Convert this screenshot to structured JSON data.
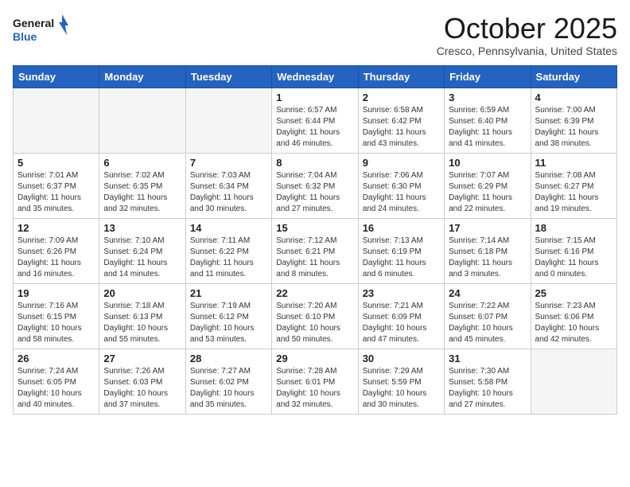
{
  "header": {
    "logo_line1": "General",
    "logo_line2": "Blue",
    "month": "October 2025",
    "location": "Cresco, Pennsylvania, United States"
  },
  "weekdays": [
    "Sunday",
    "Monday",
    "Tuesday",
    "Wednesday",
    "Thursday",
    "Friday",
    "Saturday"
  ],
  "weeks": [
    [
      {
        "day": "",
        "info": ""
      },
      {
        "day": "",
        "info": ""
      },
      {
        "day": "",
        "info": ""
      },
      {
        "day": "1",
        "info": "Sunrise: 6:57 AM\nSunset: 6:44 PM\nDaylight: 11 hours\nand 46 minutes."
      },
      {
        "day": "2",
        "info": "Sunrise: 6:58 AM\nSunset: 6:42 PM\nDaylight: 11 hours\nand 43 minutes."
      },
      {
        "day": "3",
        "info": "Sunrise: 6:59 AM\nSunset: 6:40 PM\nDaylight: 11 hours\nand 41 minutes."
      },
      {
        "day": "4",
        "info": "Sunrise: 7:00 AM\nSunset: 6:39 PM\nDaylight: 11 hours\nand 38 minutes."
      }
    ],
    [
      {
        "day": "5",
        "info": "Sunrise: 7:01 AM\nSunset: 6:37 PM\nDaylight: 11 hours\nand 35 minutes."
      },
      {
        "day": "6",
        "info": "Sunrise: 7:02 AM\nSunset: 6:35 PM\nDaylight: 11 hours\nand 32 minutes."
      },
      {
        "day": "7",
        "info": "Sunrise: 7:03 AM\nSunset: 6:34 PM\nDaylight: 11 hours\nand 30 minutes."
      },
      {
        "day": "8",
        "info": "Sunrise: 7:04 AM\nSunset: 6:32 PM\nDaylight: 11 hours\nand 27 minutes."
      },
      {
        "day": "9",
        "info": "Sunrise: 7:06 AM\nSunset: 6:30 PM\nDaylight: 11 hours\nand 24 minutes."
      },
      {
        "day": "10",
        "info": "Sunrise: 7:07 AM\nSunset: 6:29 PM\nDaylight: 11 hours\nand 22 minutes."
      },
      {
        "day": "11",
        "info": "Sunrise: 7:08 AM\nSunset: 6:27 PM\nDaylight: 11 hours\nand 19 minutes."
      }
    ],
    [
      {
        "day": "12",
        "info": "Sunrise: 7:09 AM\nSunset: 6:26 PM\nDaylight: 11 hours\nand 16 minutes."
      },
      {
        "day": "13",
        "info": "Sunrise: 7:10 AM\nSunset: 6:24 PM\nDaylight: 11 hours\nand 14 minutes."
      },
      {
        "day": "14",
        "info": "Sunrise: 7:11 AM\nSunset: 6:22 PM\nDaylight: 11 hours\nand 11 minutes."
      },
      {
        "day": "15",
        "info": "Sunrise: 7:12 AM\nSunset: 6:21 PM\nDaylight: 11 hours\nand 8 minutes."
      },
      {
        "day": "16",
        "info": "Sunrise: 7:13 AM\nSunset: 6:19 PM\nDaylight: 11 hours\nand 6 minutes."
      },
      {
        "day": "17",
        "info": "Sunrise: 7:14 AM\nSunset: 6:18 PM\nDaylight: 11 hours\nand 3 minutes."
      },
      {
        "day": "18",
        "info": "Sunrise: 7:15 AM\nSunset: 6:16 PM\nDaylight: 11 hours\nand 0 minutes."
      }
    ],
    [
      {
        "day": "19",
        "info": "Sunrise: 7:16 AM\nSunset: 6:15 PM\nDaylight: 10 hours\nand 58 minutes."
      },
      {
        "day": "20",
        "info": "Sunrise: 7:18 AM\nSunset: 6:13 PM\nDaylight: 10 hours\nand 55 minutes."
      },
      {
        "day": "21",
        "info": "Sunrise: 7:19 AM\nSunset: 6:12 PM\nDaylight: 10 hours\nand 53 minutes."
      },
      {
        "day": "22",
        "info": "Sunrise: 7:20 AM\nSunset: 6:10 PM\nDaylight: 10 hours\nand 50 minutes."
      },
      {
        "day": "23",
        "info": "Sunrise: 7:21 AM\nSunset: 6:09 PM\nDaylight: 10 hours\nand 47 minutes."
      },
      {
        "day": "24",
        "info": "Sunrise: 7:22 AM\nSunset: 6:07 PM\nDaylight: 10 hours\nand 45 minutes."
      },
      {
        "day": "25",
        "info": "Sunrise: 7:23 AM\nSunset: 6:06 PM\nDaylight: 10 hours\nand 42 minutes."
      }
    ],
    [
      {
        "day": "26",
        "info": "Sunrise: 7:24 AM\nSunset: 6:05 PM\nDaylight: 10 hours\nand 40 minutes."
      },
      {
        "day": "27",
        "info": "Sunrise: 7:26 AM\nSunset: 6:03 PM\nDaylight: 10 hours\nand 37 minutes."
      },
      {
        "day": "28",
        "info": "Sunrise: 7:27 AM\nSunset: 6:02 PM\nDaylight: 10 hours\nand 35 minutes."
      },
      {
        "day": "29",
        "info": "Sunrise: 7:28 AM\nSunset: 6:01 PM\nDaylight: 10 hours\nand 32 minutes."
      },
      {
        "day": "30",
        "info": "Sunrise: 7:29 AM\nSunset: 5:59 PM\nDaylight: 10 hours\nand 30 minutes."
      },
      {
        "day": "31",
        "info": "Sunrise: 7:30 AM\nSunset: 5:58 PM\nDaylight: 10 hours\nand 27 minutes."
      },
      {
        "day": "",
        "info": ""
      }
    ]
  ]
}
